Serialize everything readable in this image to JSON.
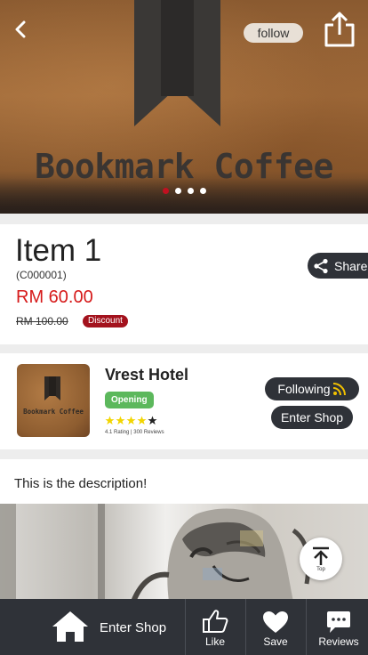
{
  "header": {
    "follow_label": "follow",
    "brand_text": "Bookmark Coffee",
    "carousel": {
      "count": 4,
      "active_index": 0
    }
  },
  "item": {
    "title": "Item 1",
    "code": "(C000001)",
    "price": "RM 60.00",
    "original_price": "RM 100.00",
    "discount_label": "Discount",
    "share_label": "Share"
  },
  "shop": {
    "name": "Vrest Hotel",
    "logo_text": "Bookmark Coffee",
    "status": "Opening",
    "rating_value": 4.1,
    "rating_text": "4.1 Rating | 300 Reviews",
    "following_label": "Following",
    "enter_label": "Enter Shop"
  },
  "description": {
    "text": "This is the description!",
    "top_label": "Top"
  },
  "bottom_bar": {
    "enter_label": "Enter Shop",
    "like_label": "Like",
    "save_label": "Save",
    "reviews_label": "Reviews"
  },
  "colors": {
    "dark": "#2f3238",
    "price_red": "#d61a1a",
    "discount_red": "#a3121d",
    "opening_green": "#5cb85c",
    "active_dot": "#c01020",
    "star_yellow": "#f2d500"
  }
}
